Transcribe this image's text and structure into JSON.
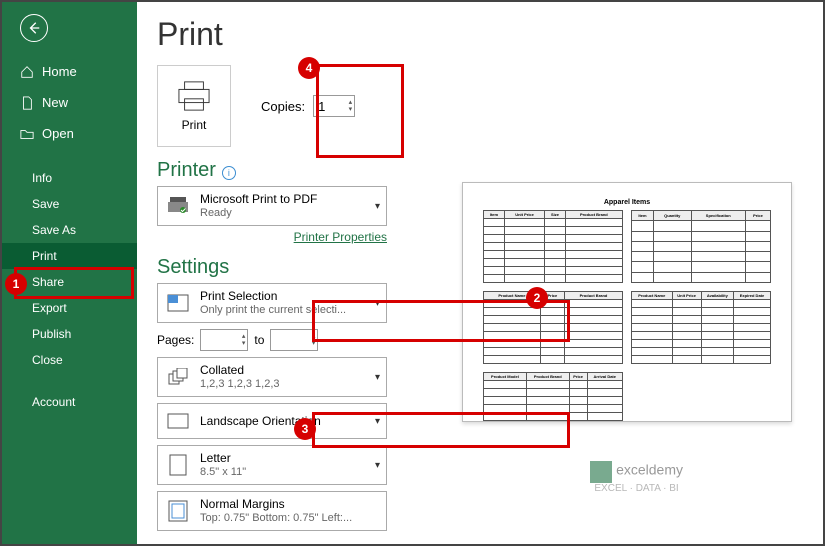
{
  "sidebar": {
    "home": "Home",
    "new": "New",
    "open": "Open",
    "info": "Info",
    "save": "Save",
    "saveAs": "Save As",
    "print": "Print",
    "share": "Share",
    "export": "Export",
    "publish": "Publish",
    "close": "Close",
    "account": "Account"
  },
  "title": "Print",
  "printButton": "Print",
  "copiesLabel": "Copies:",
  "copiesValue": "1",
  "printerHeading": "Printer",
  "printer": {
    "name": "Microsoft Print to PDF",
    "status": "Ready"
  },
  "printerProps": "Printer Properties",
  "settingsHeading": "Settings",
  "printWhat": {
    "title": "Print Selection",
    "sub": "Only print the current selecti..."
  },
  "pagesLabel": "Pages:",
  "pagesTo": "to",
  "collated": {
    "title": "Collated",
    "sub": "1,2,3    1,2,3    1,2,3"
  },
  "orientation": "Landscape Orientation",
  "paper": {
    "title": "Letter",
    "sub": "8.5\" x 11\""
  },
  "margins": {
    "title": "Normal Margins",
    "sub": "Top: 0.75\" Bottom: 0.75\" Left:..."
  },
  "preview": {
    "title": "Apparel Items",
    "t1": {
      "headers": [
        "Item",
        "Unit Price",
        "Size",
        "Product Brand"
      ],
      "rows": 8
    },
    "t2": {
      "headers": [
        "Item",
        "Quantity",
        "Specification",
        "Price"
      ],
      "rows": 6
    },
    "t3": {
      "headers": [
        "Product Name",
        "Price",
        "Product Brand"
      ],
      "rows": 8
    },
    "t4": {
      "headers": [
        "Product Name",
        "Unit Price",
        "Availability",
        "Expired Date"
      ],
      "rows": 8
    },
    "t5": {
      "headers": [
        "Product Model",
        "Product Brand",
        "Price",
        "Arrival Date"
      ],
      "rows": 5
    }
  },
  "watermark": {
    "brand": "exceldemy",
    "tag": "EXCEL · DATA · BI"
  },
  "badges": {
    "b1": "1",
    "b2": "2",
    "b3": "3",
    "b4": "4"
  }
}
